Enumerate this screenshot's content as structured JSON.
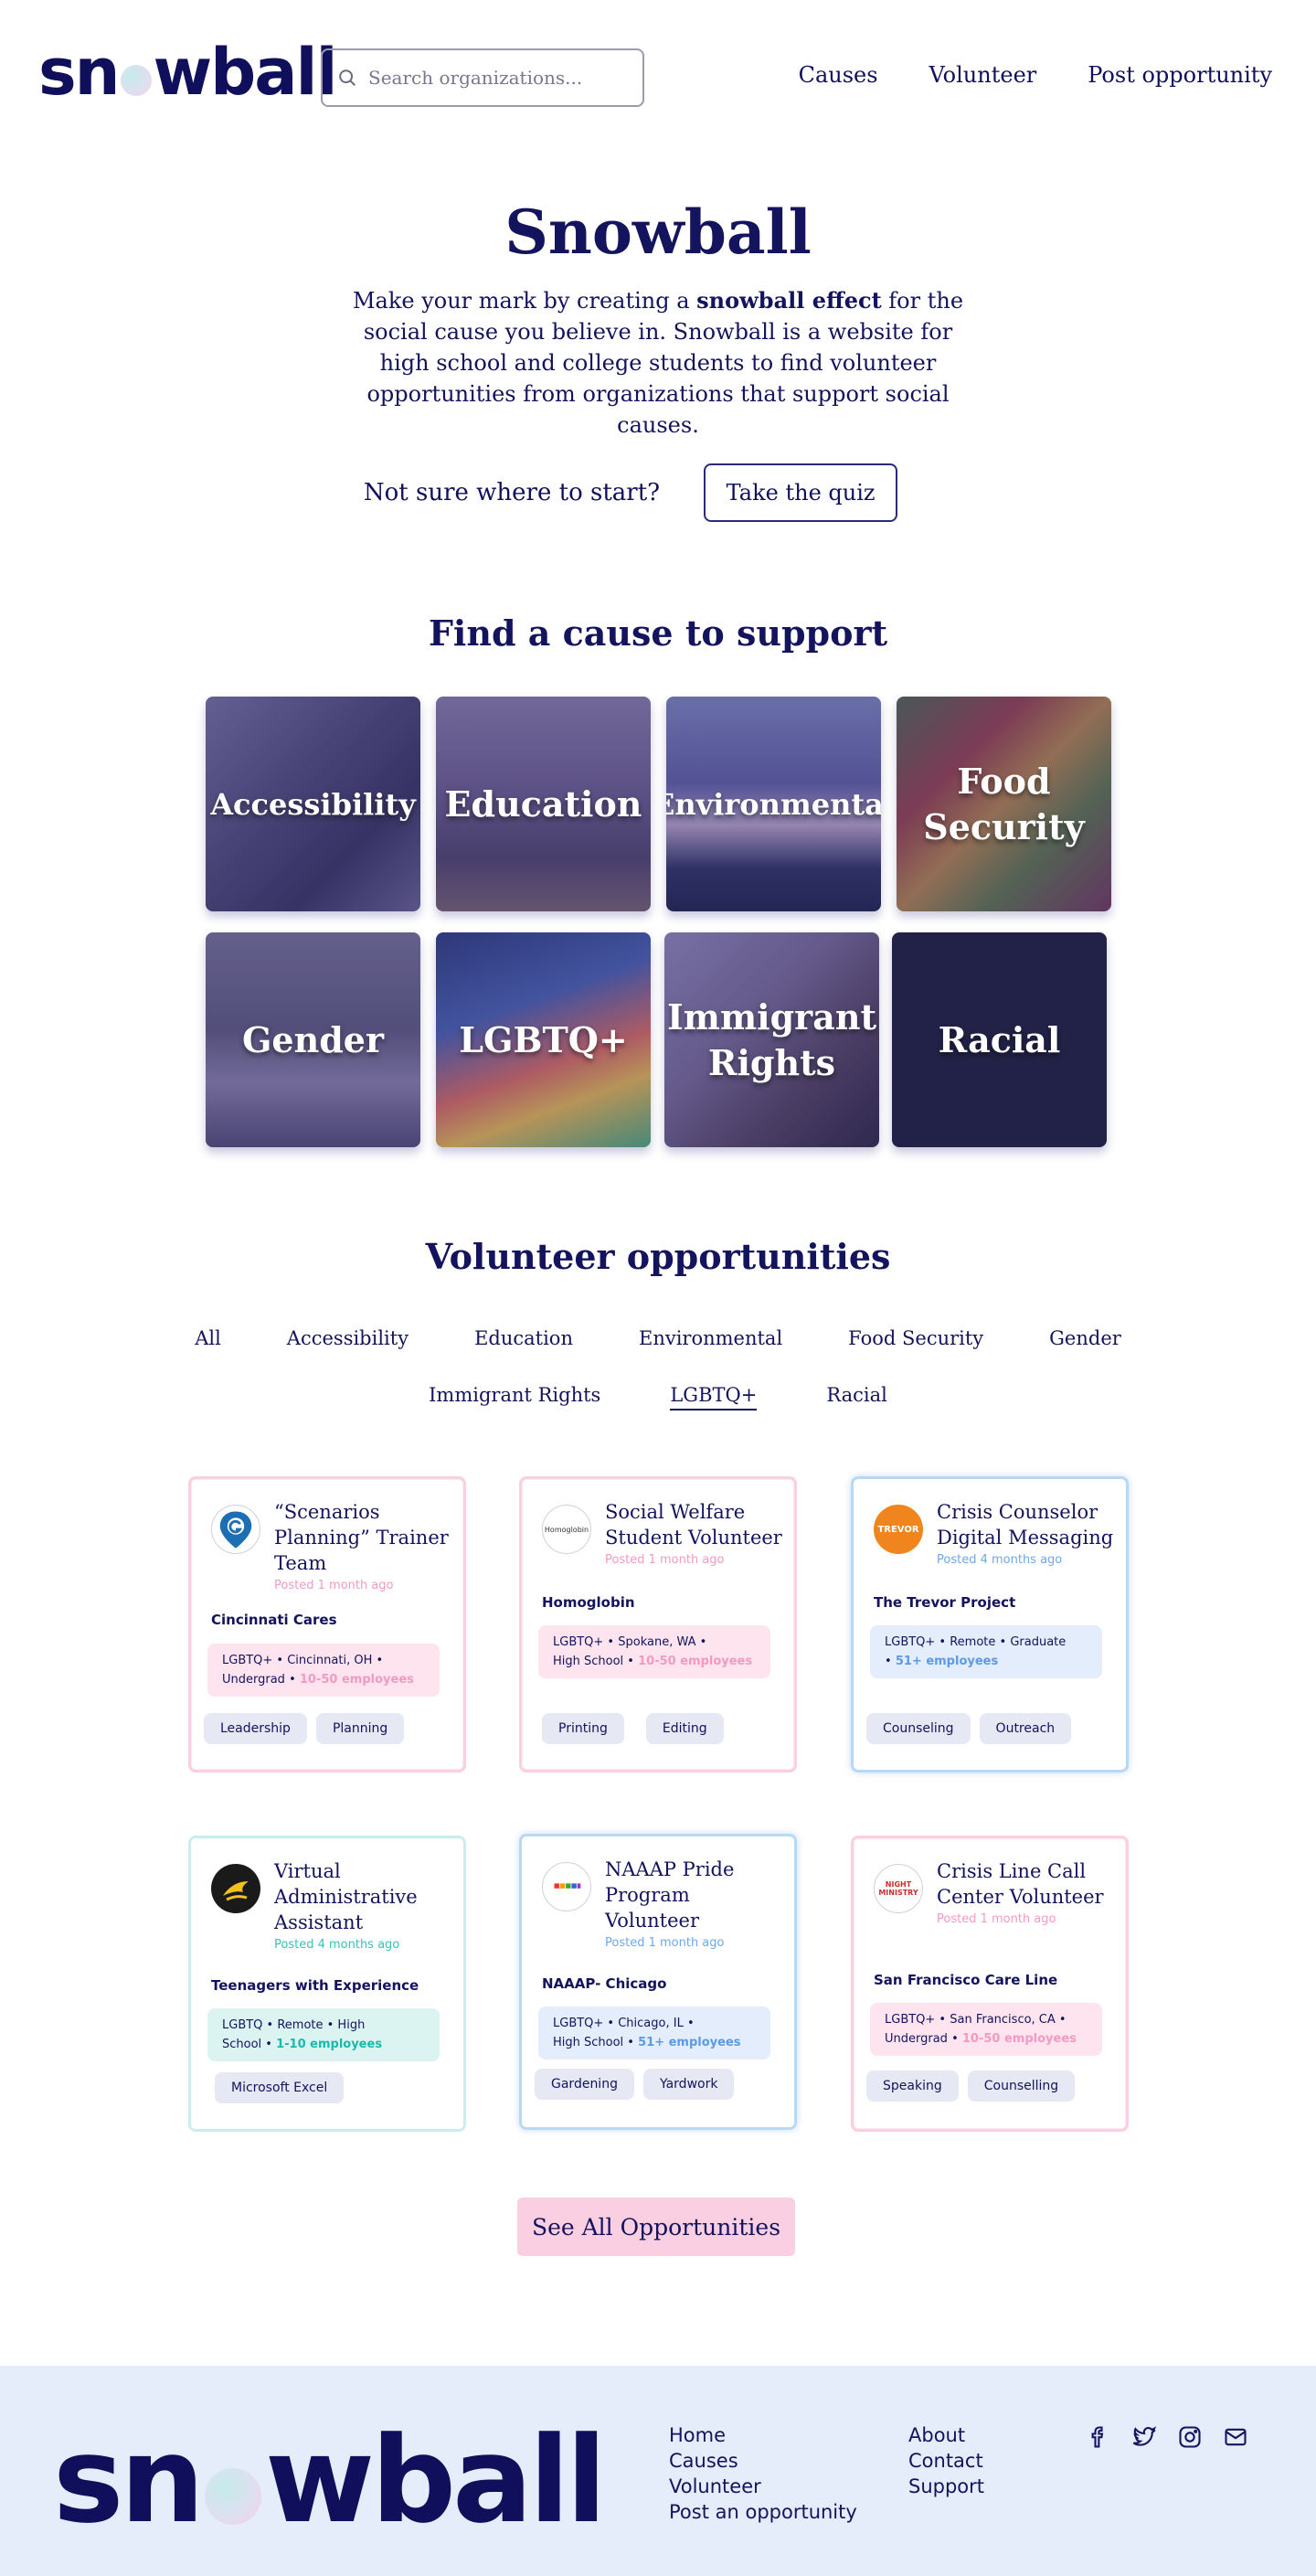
{
  "header": {
    "logo": {
      "pre": "sn",
      "post": "wball"
    },
    "search_placeholder": "Search organizations...",
    "nav": [
      "Causes",
      "Volunteer",
      "Post opportunity"
    ]
  },
  "hero": {
    "title": "Snowball",
    "desc_1": "Make your mark by creating a ",
    "desc_bold": "snowball effect",
    "desc_2": " for the social cause you believe in. Snowball is a website for high school and college students to find volunteer opportunities from organizations that support social causes.",
    "quiz_prompt": "Not sure where to start?",
    "quiz_button": "Take the quiz"
  },
  "causes": {
    "title": "Find a cause to support",
    "items": [
      "Accessibility",
      "Education",
      "Environmental",
      "Food Security",
      "Gender",
      "LGBTQ+",
      "Immigrant Rights",
      "Racial"
    ]
  },
  "opportunities": {
    "title": "Volunteer opportunities",
    "filters_row1": [
      "All",
      "Accessibility",
      "Education",
      "Environmental",
      "Food Security",
      "Gender"
    ],
    "filters_row2": [
      "Immigrant Rights",
      "LGBTQ+",
      "Racial"
    ],
    "active_filter": "LGBTQ+",
    "cards": [
      {
        "title": "“Scenarios Planning” Trainer Team",
        "posted": "Posted 1 month ago",
        "org": "Cincinnati Cares",
        "meta1": "LGBTQ+  •  Cincinnati, OH  •",
        "meta2": "Undergrad  •  ",
        "employees": "10-50 employees",
        "tags": [
          "Leadership",
          "Planning"
        ],
        "logo_text": ""
      },
      {
        "title": "Social Welfare Student Volunteer",
        "posted": "Posted 1 month ago",
        "org": "Homoglobin",
        "meta1": "LGBTQ+  •  Spokane, WA  •",
        "meta2": "High School  •  ",
        "employees": "10-50 employees",
        "tags": [
          "Printing",
          "Editing"
        ],
        "logo_text": "Homoglobin"
      },
      {
        "title": "Crisis Counselor Digital Messaging",
        "posted": "Posted 4 months ago",
        "org": "The Trevor Project",
        "meta1": "LGBTQ+  •  Remote  •  Graduate",
        "meta2": "•  ",
        "employees": "51+ employees",
        "tags": [
          "Counseling",
          "Outreach"
        ],
        "logo_text": "TREVOR"
      },
      {
        "title": "Virtual Administrative Assistant",
        "posted": "Posted 4 months ago",
        "org": "Teenagers with Experience",
        "meta1": "LGBTQ  •  Remote  •  High",
        "meta2": "School  •  ",
        "employees": "1-10 employees",
        "tags": [
          "Microsoft Excel"
        ],
        "logo_text": ""
      },
      {
        "title": "NAAAP Pride Program Volunteer",
        "posted": "Posted 1 month ago",
        "org": "NAAAP- Chicago",
        "meta1": "LGBTQ+  •  Chicago, IL  •",
        "meta2": "High School  •  ",
        "employees": "51+ employees",
        "tags": [
          "Gardening",
          "Yardwork"
        ],
        "logo_text": ""
      },
      {
        "title": "Crisis Line Call Center Volunteer",
        "posted": "Posted 1 month ago",
        "org": "San Francisco Care Line",
        "meta1": "LGBTQ+  •  San Francisco, CA  •",
        "meta2": "Undergrad  •  ",
        "employees": "10-50 employees",
        "tags": [
          "Speaking",
          "Counselling"
        ],
        "logo_text": "NIGHT MINISTRY"
      }
    ],
    "see_all": "See All Opportunities"
  },
  "footer": {
    "col1": [
      "Home",
      "Causes",
      "Volunteer",
      "Post an opportunity"
    ],
    "col2": [
      "About",
      "Contact",
      "Support"
    ],
    "socials": [
      "facebook-icon",
      "twitter-icon",
      "instagram-icon",
      "mail-icon"
    ]
  },
  "colors": {
    "navy": "#13135e",
    "pink": "#f9cfe1",
    "blue": "#b9d8f6",
    "teal": "#c9eeee",
    "footer_bg": "#e5ecfa"
  }
}
